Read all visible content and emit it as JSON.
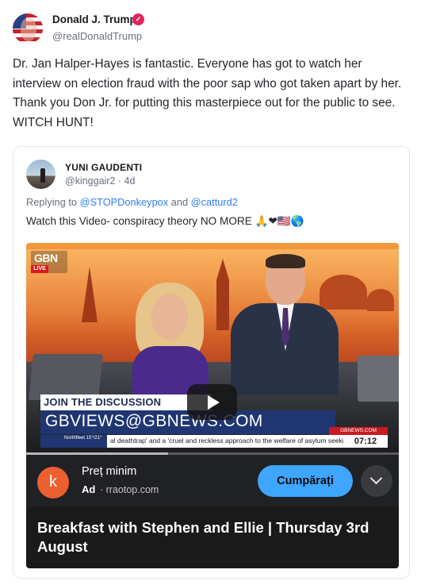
{
  "post": {
    "author_name": "Donald J. Trump",
    "author_handle": "@realDonaldTrump",
    "verified_icon": "check",
    "body": "Dr. Jan Halper-Hayes is fantastic. Everyone has got to watch her interview on election fraud with the poor sap who got taken apart by her. Thank you Don Jr. for putting this masterpiece out for the public to see. WITCH HUNT!"
  },
  "quote": {
    "author_name": "YUNI GAUDENTI",
    "author_handle": "@kinggair2",
    "age": "· 4d",
    "replying_prefix": "Replying to ",
    "mention_1": "@STOPDonkeypox",
    "replying_and": " and ",
    "mention_2": "@catturd2",
    "text": "Watch this Video- conspiracy theory NO MORE",
    "emojis": "🙏❤🇺🇸🌎",
    "video": {
      "logo": "GBN",
      "live": "LIVE",
      "banner_join": "JOIN THE DISCUSSION",
      "banner_email": "GBVIEWS@GBNEWS.COM",
      "ticker_brand": "Northfleet 15°/21°",
      "ticker_text": "al deathtrap' and a 'cruel and reckless approach to the welfare of asylum seeki",
      "channel_url": "GBNEWS.COM",
      "time": "07:12",
      "progress_fraction": 0.38
    },
    "ad": {
      "logo_letter": "k",
      "title": "Preț minim",
      "badge": "Ad",
      "domain": "· rraotop.com",
      "cta": "Cumpărați"
    },
    "video_title": "Breakfast with Stephen and Ellie | Thursday 3rd August"
  }
}
